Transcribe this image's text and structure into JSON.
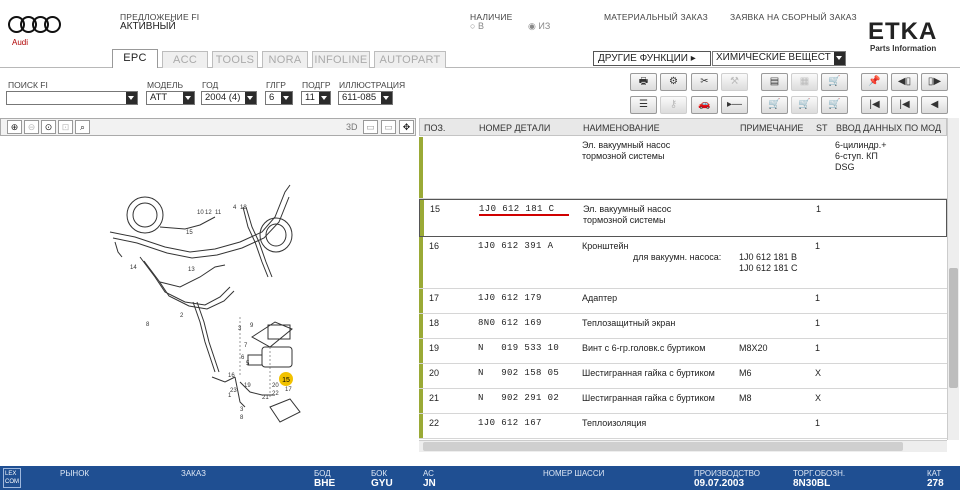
{
  "header": {
    "brand": "Audi",
    "offer_label": "ПРЕДЛОЖЕНИЕ FI",
    "offer_value": "АКТИВНЫЙ",
    "availability_label": "НАЛИЧИЕ",
    "availability_opt1": "В",
    "availability_opt2": "ИЗ",
    "material_order": "МАТЕРИАЛЬНЫЙ ЗАКАЗ",
    "assembly_order": "ЗАЯВКА НА СБОРНЫЙ ЗАКАЗ",
    "etka_logo": "ETKA",
    "etka_sub": "Parts Information"
  },
  "tabs": [
    "EPC",
    "ACC",
    "TOOLS",
    "NORA",
    "INFOLINE",
    "AUTOPART"
  ],
  "functions": {
    "other_functions": "ДРУГИЕ ФУНКЦИИ",
    "chemicals": "ХИМИЧЕСКИЕ ВЕЩЕСТ"
  },
  "filters": {
    "search_label": "ПОИСК FI",
    "search_value": "",
    "model_label": "МОДЕЛЬ",
    "model_value": "ATT",
    "year_label": "ГОД",
    "year_value": "2004 (4)",
    "mgroup_label": "ГЛГР",
    "mgroup_value": "6",
    "subgroup_label": "ПОДГР",
    "subgroup_value": "11",
    "illustration_label": "ИЛЛЮСТРАЦИЯ",
    "illustration_value": "611-085"
  },
  "left_toolbar": {
    "btn_3d": "3D"
  },
  "illustration": {
    "callouts": [
      "10",
      "12",
      "11",
      "4",
      "18",
      "15",
      "14",
      "13",
      "8",
      "2",
      "3",
      "9",
      "7",
      "6",
      "5",
      "16",
      "19",
      "20",
      "21",
      "22",
      "17",
      "23",
      "1",
      "3",
      "8"
    ],
    "highlight": "15"
  },
  "table": {
    "headers": {
      "pos": "ПОЗ.",
      "part": "НОМЕР ДЕТАЛИ",
      "name": "НАИМЕНОВАНИЕ",
      "note": "ПРИМЕЧАНИЕ",
      "st": "ST",
      "input": "ВВОД ДАННЫХ ПО МОД"
    },
    "rows": [
      {
        "pos": "",
        "part": "",
        "name": "Эл. вакуумный насос",
        "name2": "тормозной системы",
        "note": "",
        "note2": "",
        "note3": "",
        "st": "",
        "input": "6-цилиндр.+",
        "input2": "6-ступ. КП",
        "input3": "DSG"
      },
      {
        "pos": "15",
        "part": "1J0 612 181 C",
        "name": "Эл. вакуумный насос",
        "name2": "тормозной системы",
        "note": "",
        "note2": "",
        "note3": "",
        "st": "1",
        "input": "",
        "input2": "",
        "input3": ""
      },
      {
        "pos": "16",
        "part": "1J0 612 391 A",
        "name": "Кронштейн",
        "name2": "для вакуумн. насоса:",
        "note": "",
        "note2": "1J0 612 181 B",
        "note3": "1J0 612 181 C",
        "st": "1",
        "input": "",
        "input2": "",
        "input3": ""
      },
      {
        "pos": "17",
        "part": "1J0 612 179",
        "name": "Адаптер",
        "name2": "",
        "note": "",
        "note2": "",
        "note3": "",
        "st": "1",
        "input": "",
        "input2": "",
        "input3": ""
      },
      {
        "pos": "18",
        "part": "8N0 612 169",
        "name": "Теплозащитный экран",
        "name2": "",
        "note": "",
        "note2": "",
        "note3": "",
        "st": "1",
        "input": "",
        "input2": "",
        "input3": ""
      },
      {
        "pos": "19",
        "part": "N   019 533 10",
        "name": "Винт с 6-гр.головк.с буртиком",
        "name2": "",
        "note": "M8X20",
        "note2": "",
        "note3": "",
        "st": "1",
        "input": "",
        "input2": "",
        "input3": ""
      },
      {
        "pos": "20",
        "part": "N   902 158 05",
        "name": "Шестигранная гайка с буртиком",
        "name2": "",
        "note": "M6",
        "note2": "",
        "note3": "",
        "st": "X",
        "input": "",
        "input2": "",
        "input3": ""
      },
      {
        "pos": "21",
        "part": "N   902 291 02",
        "name": "Шестигранная гайка с буртиком",
        "name2": "",
        "note": "M8",
        "note2": "",
        "note3": "",
        "st": "X",
        "input": "",
        "input2": "",
        "input3": ""
      },
      {
        "pos": "22",
        "part": "1J0 612 167",
        "name": "Теплоизоляция",
        "name2": "",
        "note": "",
        "note2": "",
        "note3": "",
        "st": "1",
        "input": "",
        "input2": "",
        "input3": ""
      }
    ]
  },
  "status_bar": {
    "logo": "LEX\nCOM",
    "market_label": "РЫНОК",
    "market_value": "",
    "order_label": "ЗАКАЗ",
    "order_value": "",
    "bod_label": "БОД",
    "bod_value": "BHE",
    "bok_label": "БОК",
    "bok_value": "GYU",
    "ac_label": "АС",
    "ac_value": "JN",
    "chassis_label": "НОМЕР ШАССИ",
    "chassis_value": "",
    "prod_label": "ПРОИЗВОДСТВО",
    "prod_value": "09.07.2003",
    "trade_label": "ТОРГ.ОБОЗН.",
    "trade_value": "8N30BL",
    "cat_label": "КАТ",
    "cat_value": "278"
  },
  "colors": {
    "row_marker": "#9aaa36",
    "status_bg": "#1f4f92",
    "underline": "#d00000",
    "callout_highlight": "#f2c200"
  }
}
